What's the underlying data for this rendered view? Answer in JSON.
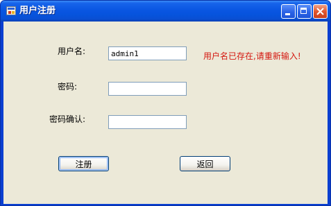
{
  "window": {
    "title": "用户注册"
  },
  "form": {
    "username_label": "用户名:",
    "username_value": "admin1",
    "password_label": "密码:",
    "password_value": "",
    "confirm_label": "密码确认:",
    "confirm_value": "",
    "error_message": "用户名已存在,请重新输入!"
  },
  "buttons": {
    "register": "注册",
    "back": "返回"
  },
  "colors": {
    "error": "#d4170f",
    "titlebar": "#0a56e2",
    "client_bg": "#ece9d8"
  }
}
